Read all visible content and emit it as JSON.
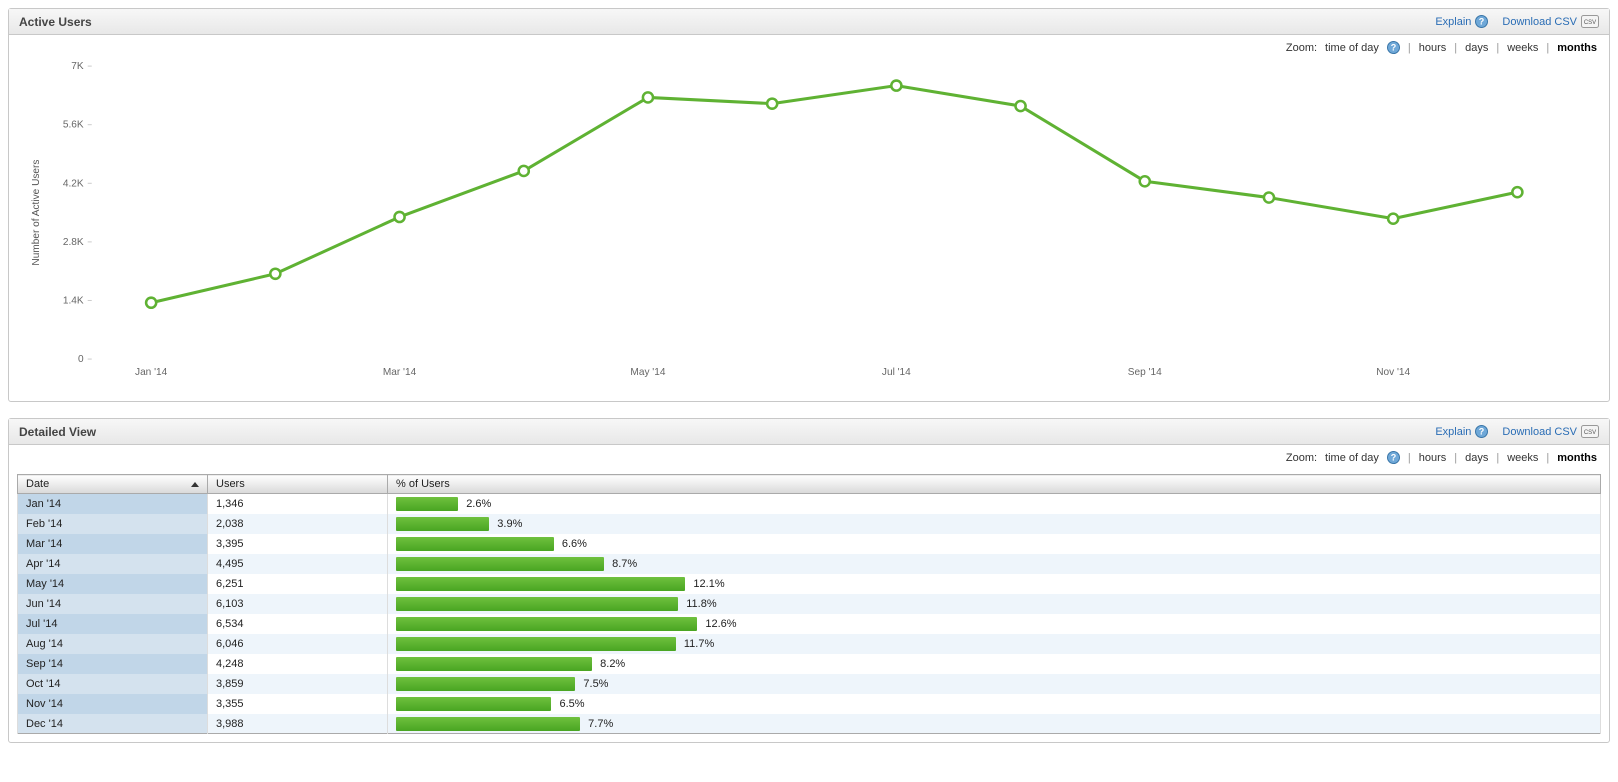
{
  "panels": {
    "chart": {
      "title": "Active Users",
      "explain": "Explain",
      "download": "Download CSV"
    },
    "table": {
      "title": "Detailed View",
      "explain": "Explain",
      "download": "Download CSV"
    }
  },
  "zoom": {
    "label": "Zoom:",
    "options": [
      "time of day",
      "hours",
      "days",
      "weeks",
      "months"
    ],
    "active": "months"
  },
  "chart_data": {
    "type": "line",
    "title": "",
    "ylabel": "Number of Active Users",
    "xlabel": "",
    "ylim": [
      0,
      7000
    ],
    "yticks": [
      0,
      1400,
      2800,
      4200,
      5600,
      7000
    ],
    "ytick_labels": [
      "0",
      "1.4K",
      "2.8K",
      "4.2K",
      "5.6K",
      "7K"
    ],
    "categories": [
      "Jan '14",
      "Feb '14",
      "Mar '14",
      "Apr '14",
      "May '14",
      "Jun '14",
      "Jul '14",
      "Aug '14",
      "Sep '14",
      "Oct '14",
      "Nov '14",
      "Dec '14"
    ],
    "xtick_indices": [
      0,
      2,
      4,
      6,
      8,
      10
    ],
    "values": [
      1346,
      2038,
      3395,
      4495,
      6251,
      6103,
      6534,
      6046,
      4248,
      3859,
      3355,
      3988
    ],
    "series_color": "#5fb233"
  },
  "table": {
    "columns": [
      "Date",
      "Users",
      "% of Users"
    ],
    "bar_max_pct": 25,
    "rows": [
      {
        "date": "Jan '14",
        "users": "1,346",
        "pct": 2.6
      },
      {
        "date": "Feb '14",
        "users": "2,038",
        "pct": 3.9
      },
      {
        "date": "Mar '14",
        "users": "3,395",
        "pct": 6.6
      },
      {
        "date": "Apr '14",
        "users": "4,495",
        "pct": 8.7
      },
      {
        "date": "May '14",
        "users": "6,251",
        "pct": 12.1
      },
      {
        "date": "Jun '14",
        "users": "6,103",
        "pct": 11.8
      },
      {
        "date": "Jul '14",
        "users": "6,534",
        "pct": 12.6
      },
      {
        "date": "Aug '14",
        "users": "6,046",
        "pct": 11.7
      },
      {
        "date": "Sep '14",
        "users": "4,248",
        "pct": 8.2
      },
      {
        "date": "Oct '14",
        "users": "3,859",
        "pct": 7.5
      },
      {
        "date": "Nov '14",
        "users": "3,355",
        "pct": 6.5
      },
      {
        "date": "Dec '14",
        "users": "3,988",
        "pct": 7.7
      }
    ]
  }
}
